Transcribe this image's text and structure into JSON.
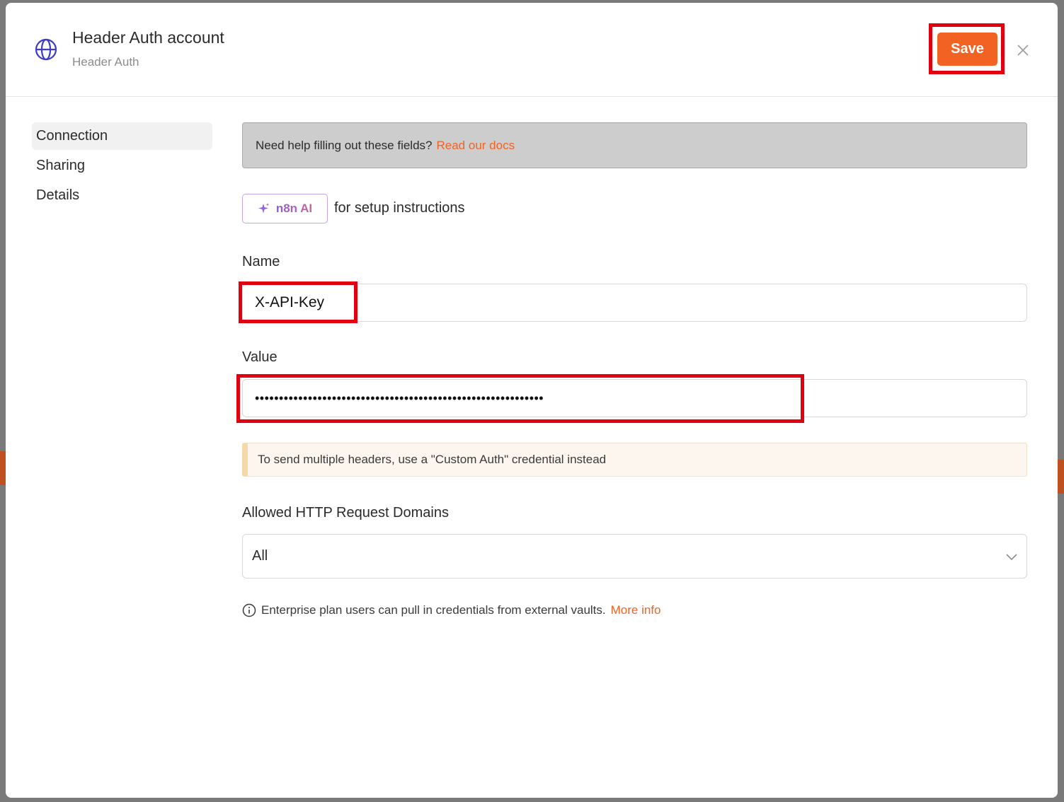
{
  "header": {
    "title": "Header Auth account",
    "subtitle": "Header Auth",
    "save_label": "Save"
  },
  "sidebar": {
    "items": [
      {
        "label": "Connection",
        "active": true
      },
      {
        "label": "Sharing",
        "active": false
      },
      {
        "label": "Details",
        "active": false
      }
    ]
  },
  "help": {
    "text": "Need help filling out these fields?",
    "link": "Read our docs"
  },
  "ai": {
    "button_label": "n8n AI",
    "hint": "for setup instructions"
  },
  "fields": {
    "name_label": "Name",
    "name_value": "X-API-Key",
    "value_label": "Value",
    "value_masked": "••••••••••••••••••••••••••••••••••••••••••••••••••••••••••••"
  },
  "notice": {
    "text": "To send multiple headers, use a \"Custom Auth\" credential instead"
  },
  "domains": {
    "label": "Allowed HTTP Request Domains",
    "selected": "All"
  },
  "footnote": {
    "text": "Enterprise plan users can pull in credentials from external vaults.",
    "link": "More info"
  },
  "colors": {
    "accent": "#f26223",
    "highlight": "#e0000f"
  }
}
